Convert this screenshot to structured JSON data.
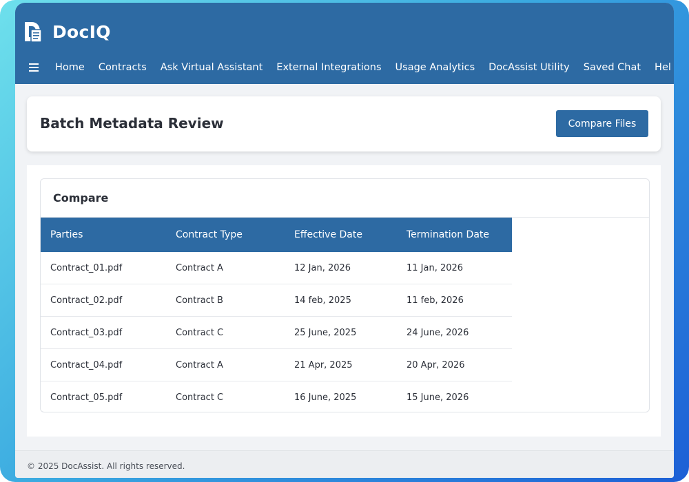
{
  "brand": {
    "name": "DocIQ"
  },
  "nav": {
    "menu_icon": "hamburger-menu-icon",
    "items": [
      {
        "label": "Home"
      },
      {
        "label": "Contracts"
      },
      {
        "label": "Ask Virtual Assistant"
      },
      {
        "label": "External Integrations"
      },
      {
        "label": "Usage Analytics"
      },
      {
        "label": "DocAssist Utility"
      },
      {
        "label": "Saved Chat"
      },
      {
        "label": "Hel"
      }
    ]
  },
  "header": {
    "title": "Batch Metadata Review",
    "compare_button": "Compare Files"
  },
  "compare": {
    "title": "Compare",
    "columns": [
      "Parties",
      "Contract Type",
      "Effective Date",
      "Termination Date"
    ],
    "rows": [
      [
        "Contract_01.pdf",
        "Contract A",
        "12 Jan, 2026",
        "11 Jan, 2026"
      ],
      [
        "Contract_02.pdf",
        "Contract B",
        "14 feb, 2025",
        "11 feb, 2026"
      ],
      [
        "Contract_03.pdf",
        "Contract C",
        "25 June, 2025",
        "24 June, 2026"
      ],
      [
        "Contract_04.pdf",
        "Contract A",
        "21 Apr, 2025",
        "20 Apr, 2026"
      ],
      [
        "Contract_05.pdf",
        "Contract C",
        "16 June, 2025",
        "15 June, 2026"
      ]
    ]
  },
  "footer": {
    "text": "© 2025 DocAssist. All rights reserved."
  },
  "colors": {
    "primary": "#2d6aa3",
    "frame_gradient_start": "#6ee0ec",
    "frame_gradient_end": "#1c5fd6",
    "background": "#f1f3f6"
  }
}
